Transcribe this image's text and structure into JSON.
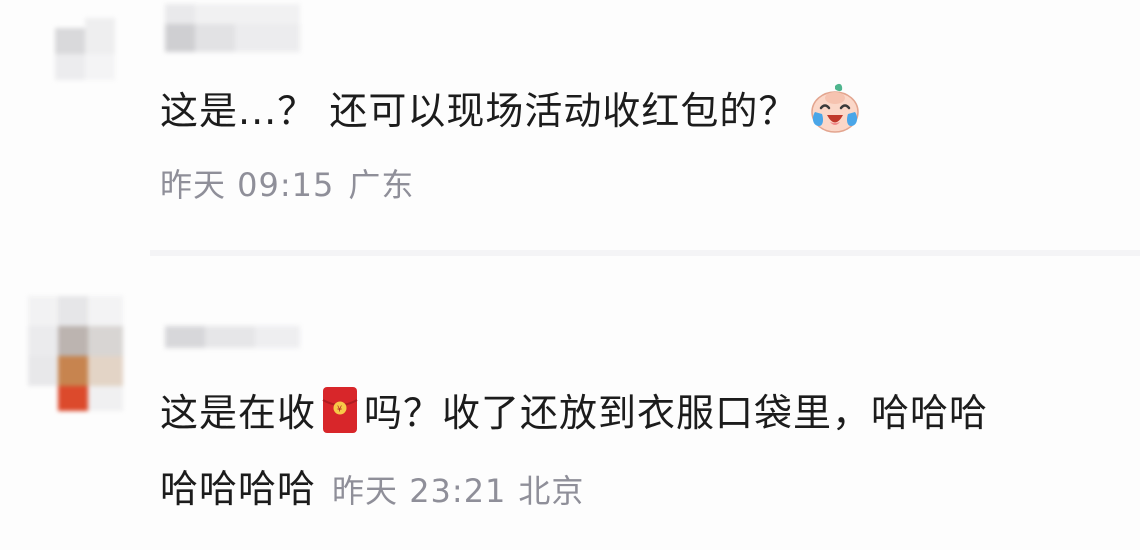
{
  "comments": [
    {
      "text_before_emoji": "这是...？ 还可以现场活动收红包的？",
      "emoji": "crying-laughing-emoji",
      "time": "昨天 09:15",
      "location": "广东"
    },
    {
      "text_part1": "这是在收",
      "inline_icon": "red-envelope-icon",
      "text_part2": "吗？收了还放到衣服口袋里，哈哈哈",
      "text_line2": "哈哈哈哈",
      "time": "昨天 23:21",
      "location": "北京"
    }
  ],
  "colors": {
    "text": "#1c1c1c",
    "meta": "#8f8f99",
    "red_envelope": "#d8262a",
    "divider": "#f4f4f6"
  }
}
